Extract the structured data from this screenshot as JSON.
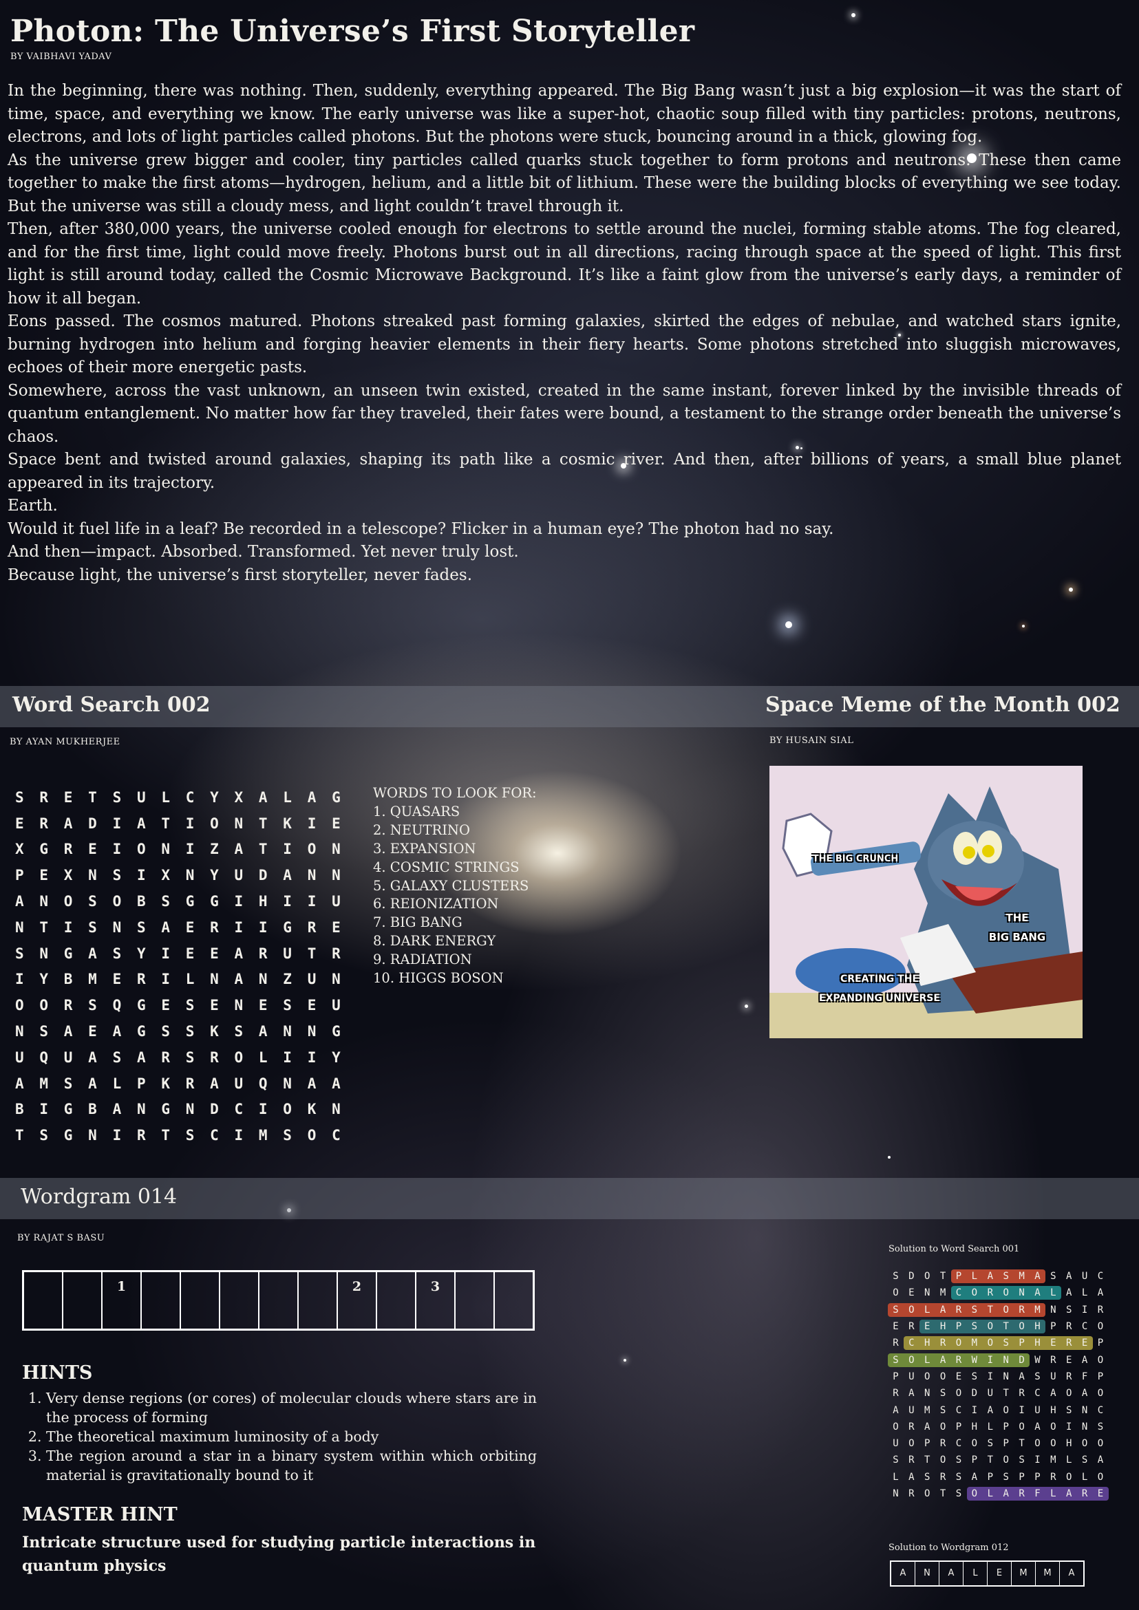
{
  "article": {
    "title": "Photon: The Universe’s First Storyteller",
    "byline": "BY VAIBHAVI YADAV",
    "paragraphs": [
      "In the beginning, there was nothing. Then, suddenly, everything appeared. The Big Bang wasn’t just a big explosion—it was the start of time, space, and everything we know. The early universe was like a super-hot, chaotic soup filled with tiny particles: protons, neutrons, electrons, and lots of light particles called photons. But the photons were stuck, bouncing around in a thick, glowing fog.",
      "As the universe grew bigger and cooler, tiny particles called quarks stuck together to form protons and neutrons. These then came together to make the first atoms—hydrogen, helium, and a little bit of lithium. These were the building blocks of everything we see today. But the universe was still a cloudy mess, and light couldn’t travel through it.",
      "Then, after 380,000 years, the universe cooled enough for electrons to settle around the nuclei, forming stable atoms. The fog cleared, and for the first time, light could move freely. Photons burst out in all directions, racing through space at the speed of light. This first light is still around today, called the Cosmic Microwave Background. It’s like a faint glow from the universe’s early days, a reminder of how it all began.",
      "Eons passed. The cosmos matured. Photons streaked past forming galaxies, skirted the edges of nebulae, and watched stars ignite, burning hydrogen into helium and forging heavier elements in their fiery hearts. Some photons stretched into sluggish microwaves, echoes of their more energetic pasts.",
      "Somewhere, across the vast unknown, an unseen twin existed, created in the same instant, forever linked by the invisible threads of quantum entanglement. No matter how far they traveled, their fates were bound, a testament to the strange order beneath the universe’s chaos.",
      "Space bent and twisted around galaxies, shaping its path like a cosmic river. And then, after billions of years, a small blue planet appeared in its trajectory.",
      "Earth.",
      "Would it fuel life in a leaf? Be recorded in a telescope? Flicker in a human eye? The photon had no say.",
      "And then—impact. Absorbed. Transformed. Yet never truly lost.",
      "Because light, the universe’s first storyteller, never fades."
    ]
  },
  "word_search": {
    "title": "Word Search 002",
    "byline": "BY AYAN MUKHERJEE",
    "grid": [
      "SRETSULCYXALAG",
      "ERADIATIONTKIE",
      "XGREIONIZATION",
      "PEXNSIXNYUDANN",
      "ANOSOBSGGIHIIU",
      "NTISNSAERIIGRE",
      "SNGASYIEEARUTR",
      "IYBMERILNANZUN",
      "OORSQGESENESEU",
      "NSAEAGSSKSANNG",
      "UQUASARSROLIIY",
      "AMSALPKRAUQNAA",
      "BIGBANGNDCIOKN",
      "TSGNIRTSCIMSOC"
    ],
    "words_heading": "WORDS TO LOOK FOR:",
    "words": [
      "1. QUASARS",
      "2. NEUTRINO",
      "3. EXPANSION",
      "4. COSMIC STRINGS",
      "5. GALAXY CLUSTERS",
      "6. REIONIZATION",
      "7. BIG BANG",
      "8. DARK ENERGY",
      "9. RADIATION",
      "10. HIGGS BOSON"
    ]
  },
  "meme": {
    "title": "Space Meme of the Month 002",
    "byline": "BY HUSAIN SIAL",
    "label_crunch": "THE BIG CRUNCH",
    "label_bang_1": "THE",
    "label_bang_2": "BIG BANG",
    "label_universe_1": "CREATING THE",
    "label_universe_2": "EXPANDING UNIVERSE"
  },
  "wordgram": {
    "title": "Wordgram 014",
    "byline": "BY RAJAT S BASU",
    "box_count": 13,
    "numbered_boxes": {
      "2": "1",
      "8": "2",
      "10": "3"
    },
    "hints_title": "HINTS",
    "hints": [
      "Very dense regions (or cores) of molecular clouds where stars are in the process of forming",
      "The theoretical maximum luminosity of a body",
      "The region around a star in a binary system within which orbiting material is gravitationally bound to it"
    ],
    "master_title": "MASTER HINT",
    "master_hint": "Intricate structure used for studying particle interactions in quantum physics"
  },
  "solution_word_search": {
    "label": "Solution to Word Search 001",
    "grid": [
      "SDOTPLASMASAUC",
      "OENMCORONALALA",
      "SOLARSTORMNSIR",
      "EREHPSOTOHPRCO",
      "RCHROMOSPHEREP",
      "SOLARWINDWREAO",
      "PUOOESINASURFP",
      "RANSODUTRCAOAO",
      "AUMSCIAOIUHSNC",
      "ORAOPHLPOAOINS",
      "UOPRCOSPTOOHOO",
      "SRTOSPTOSIMLSA",
      "LASRSAPSPPROLO",
      "NROTSOLARFLARE"
    ],
    "highlights": [
      {
        "row": 0,
        "start": 4,
        "len": 6,
        "color": "#b5462f"
      },
      {
        "row": 1,
        "start": 4,
        "len": 7,
        "color": "#1f7e7e"
      },
      {
        "row": 2,
        "start": 0,
        "len": 10,
        "color": "#b5462f"
      },
      {
        "row": 3,
        "start": 2,
        "len": 8,
        "color": "#2d6a6f"
      },
      {
        "row": 4,
        "start": 1,
        "len": 12,
        "color": "#9a8f3a"
      },
      {
        "row": 5,
        "start": 0,
        "len": 9,
        "color": "#6f8a3a"
      },
      {
        "row": 13,
        "start": 5,
        "len": 9,
        "color": "#5b3f8f"
      }
    ]
  },
  "solution_wordgram": {
    "label": "Solution to Wordgram 012",
    "letters": [
      "A",
      "N",
      "A",
      "L",
      "E",
      "M",
      "M",
      "A"
    ]
  }
}
